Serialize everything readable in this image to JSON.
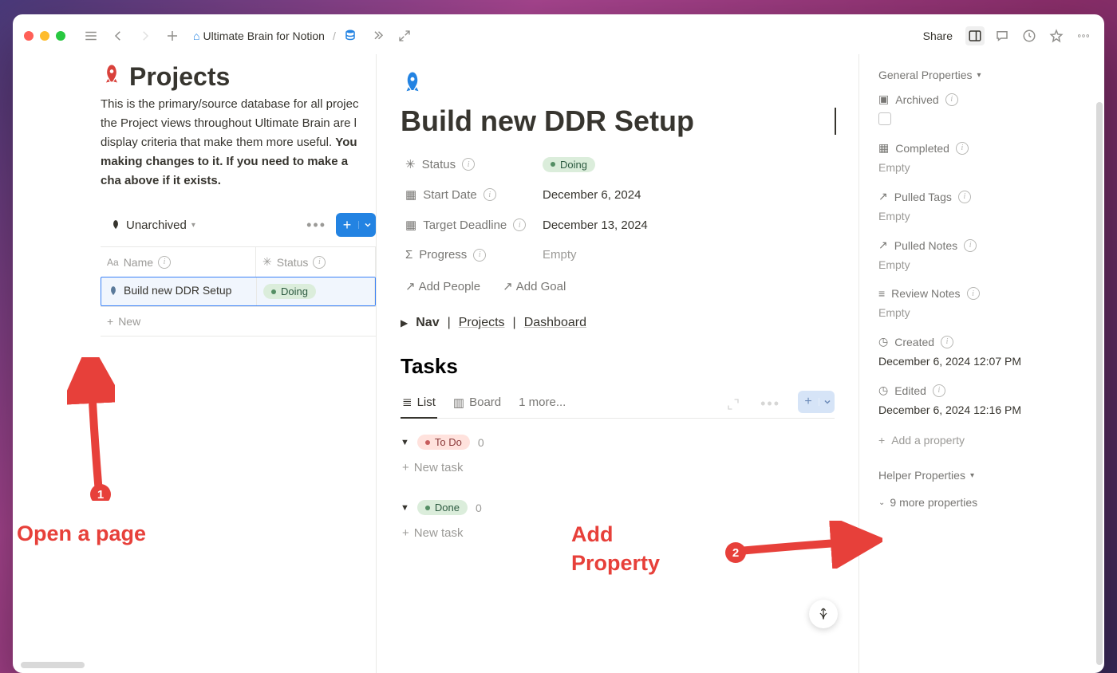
{
  "breadcrumb": {
    "item1": "Ultimate Brain for Notion"
  },
  "toolbar": {
    "share": "Share"
  },
  "left": {
    "title": "Projects",
    "intro_plain": "This is the primary/source database for all projec the Project views throughout Ultimate Brain are l display criteria that make them more useful. ",
    "intro_bold": "You making changes to it. If you need to make a cha above if it exists.",
    "view_name": "Unarchived",
    "col_name": "Name",
    "col_status": "Status",
    "row_name": "Build new DDR Setup",
    "row_status": "Doing",
    "new": "New"
  },
  "page": {
    "title": "Build new DDR Setup",
    "props": {
      "status_label": "Status",
      "status_value": "Doing",
      "start_label": "Start Date",
      "start_value": "December 6, 2024",
      "deadline_label": "Target Deadline",
      "deadline_value": "December 13, 2024",
      "progress_label": "Progress",
      "progress_value": "Empty"
    },
    "add_people": "Add People",
    "add_goal": "Add Goal",
    "nav_label": "Nav",
    "nav_projects": "Projects",
    "nav_dashboard": "Dashboard",
    "tasks_title": "Tasks",
    "tabs": {
      "list": "List",
      "board": "Board",
      "more": "1 more..."
    },
    "groups": {
      "todo_label": "To Do",
      "todo_count": "0",
      "done_label": "Done",
      "done_count": "0",
      "new_task": "New task"
    }
  },
  "right": {
    "general": "General Properties",
    "archived": "Archived",
    "completed": "Completed",
    "completed_val": "Empty",
    "pulled_tags": "Pulled Tags",
    "pulled_tags_val": "Empty",
    "pulled_notes": "Pulled Notes",
    "pulled_notes_val": "Empty",
    "review_notes": "Review Notes",
    "review_notes_val": "Empty",
    "created": "Created",
    "created_val": "December 6, 2024 12:07 PM",
    "edited": "Edited",
    "edited_val": "December 6, 2024 12:16 PM",
    "add_property": "Add a property",
    "helper": "Helper Properties",
    "more_props": "9 more properties"
  },
  "annotations": {
    "badge1": "1",
    "text1": "Open a page",
    "badge2": "2",
    "text2a": "Add",
    "text2b": "Property"
  }
}
